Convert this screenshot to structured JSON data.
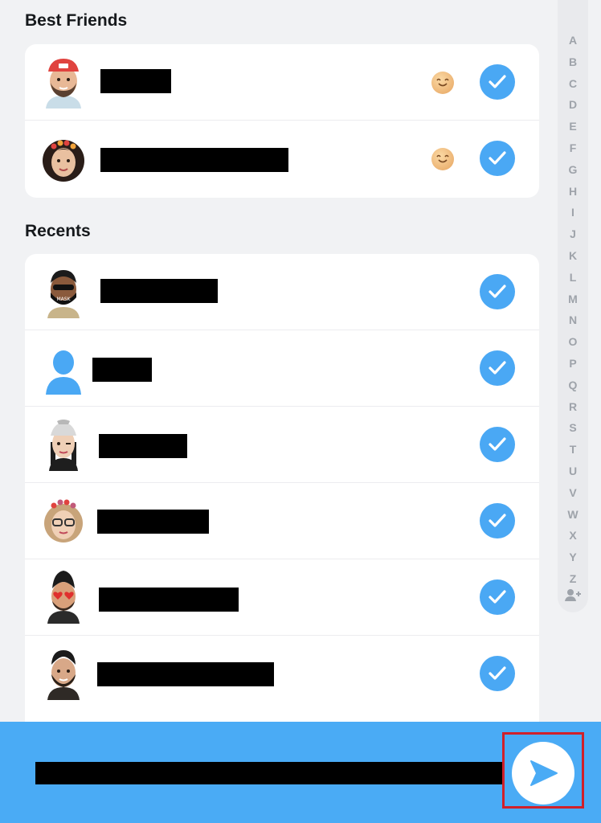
{
  "sections": {
    "best_friends": {
      "title": "Best Friends",
      "items": [
        {
          "name": "",
          "avatar": "bitmoji-red-cap-icon",
          "emoji": "smiling-face-icon",
          "selected": true
        },
        {
          "name": "",
          "avatar": "bitmoji-flower-crown-icon",
          "emoji": "smiling-face-icon",
          "selected": true
        }
      ]
    },
    "recents": {
      "title": "Recents",
      "items": [
        {
          "name": "",
          "avatar": "bitmoji-mask-icon",
          "selected": true
        },
        {
          "name": "",
          "avatar": "default-person-icon",
          "selected": true
        },
        {
          "name": "",
          "avatar": "bitmoji-cap-backwards-icon",
          "selected": true
        },
        {
          "name": "",
          "avatar": "bitmoji-glasses-icon",
          "selected": true
        },
        {
          "name": "",
          "avatar": "bitmoji-heart-eyes-icon",
          "selected": true
        },
        {
          "name": "",
          "avatar": "bitmoji-beard-icon",
          "selected": true
        }
      ]
    }
  },
  "alphabet_index": [
    "A",
    "B",
    "C",
    "D",
    "E",
    "F",
    "G",
    "H",
    "I",
    "J",
    "K",
    "L",
    "M",
    "N",
    "O",
    "P",
    "Q",
    "R",
    "S",
    "T",
    "U",
    "V",
    "W",
    "X",
    "Y",
    "Z"
  ],
  "alphabet_add_icon": "add-friend-icon",
  "send_bar": {
    "recipients_text": "",
    "send_icon": "send-arrow-icon"
  },
  "colors": {
    "accent": "#4aa8f4",
    "bar": "#4aabf5",
    "highlight": "#d0202a"
  }
}
